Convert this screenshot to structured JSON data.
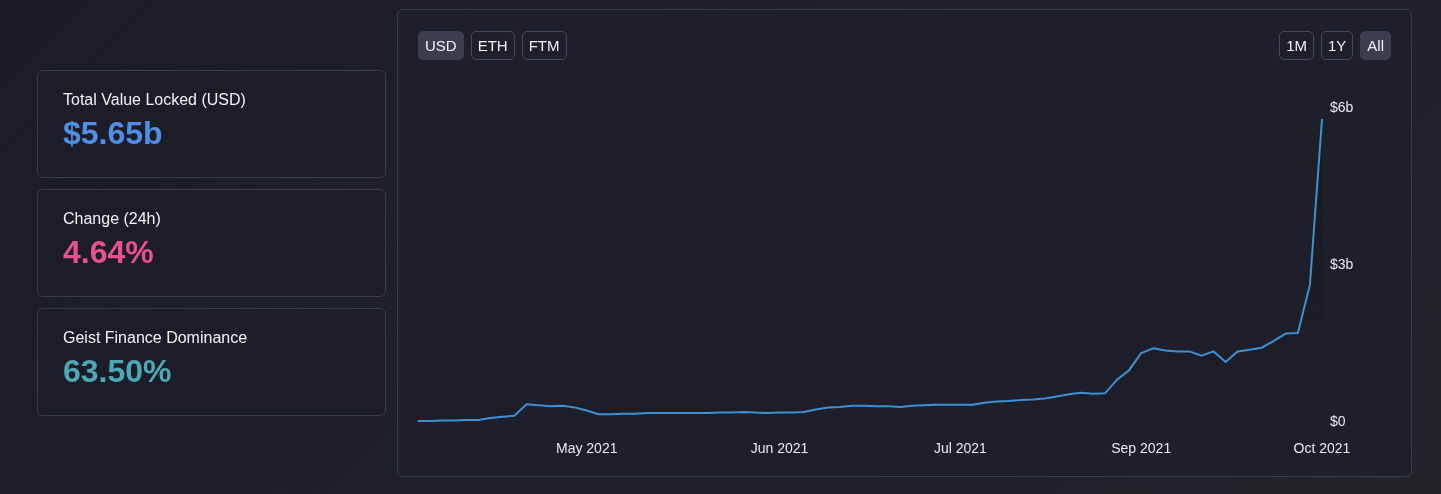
{
  "stats": [
    {
      "label": "Total Value Locked (USD)",
      "value": "$5.65b",
      "color": "#4f8fe6"
    },
    {
      "label": "Change (24h)",
      "value": "4.64%",
      "color": "#e8508f"
    },
    {
      "label": "Geist Finance Dominance",
      "value": "63.50%",
      "color": "#4aa9b4"
    }
  ],
  "chart": {
    "currencies": [
      {
        "label": "USD",
        "selected": true
      },
      {
        "label": "ETH",
        "selected": false
      },
      {
        "label": "FTM",
        "selected": false
      }
    ],
    "ranges": [
      {
        "label": "1M",
        "selected": false
      },
      {
        "label": "1Y",
        "selected": false
      },
      {
        "label": "All",
        "selected": true
      }
    ],
    "chart_data": {
      "type": "line",
      "ylim": [
        0,
        6
      ],
      "categories": [
        null,
        null,
        null,
        null,
        null,
        null,
        null,
        null,
        null,
        null,
        null,
        null,
        null,
        null,
        "May 2021",
        null,
        null,
        null,
        null,
        null,
        null,
        null,
        null,
        null,
        null,
        null,
        null,
        null,
        null,
        null,
        "Jun 2021",
        null,
        null,
        null,
        null,
        null,
        null,
        null,
        null,
        null,
        null,
        null,
        null,
        null,
        null,
        "Jul 2021",
        null,
        null,
        null,
        null,
        null,
        null,
        null,
        null,
        null,
        null,
        null,
        null,
        null,
        null,
        "Sep 2021",
        null,
        null,
        null,
        null,
        null,
        null,
        null,
        null,
        null,
        null,
        null,
        null,
        null,
        null,
        "Oct 2021"
      ],
      "yticks": [
        {
          "value": 0,
          "label": "$0"
        },
        {
          "value": 3,
          "label": "$3b"
        },
        {
          "value": 6,
          "label": "$6b"
        }
      ],
      "series": [
        {
          "color": "#3f8fd2",
          "values": [
            0,
            0,
            0.01,
            0.01,
            0.02,
            0.02,
            0.06,
            0.08,
            0.1,
            0.32,
            0.3,
            0.28,
            0.29,
            0.26,
            0.2,
            0.13,
            0.13,
            0.14,
            0.14,
            0.15,
            0.15,
            0.15,
            0.15,
            0.15,
            0.15,
            0.16,
            0.16,
            0.17,
            0.16,
            0.15,
            0.16,
            0.16,
            0.17,
            0.22,
            0.26,
            0.27,
            0.29,
            0.29,
            0.28,
            0.28,
            0.27,
            0.29,
            0.3,
            0.31,
            0.31,
            0.31,
            0.31,
            0.35,
            0.37,
            0.38,
            0.4,
            0.41,
            0.43,
            0.47,
            0.51,
            0.54,
            0.52,
            0.53,
            0.79,
            0.97,
            1.3,
            1.39,
            1.35,
            1.33,
            1.33,
            1.25,
            1.33,
            1.13,
            1.33,
            1.36,
            1.4,
            1.53,
            1.67,
            1.68,
            2.6,
            5.77
          ]
        }
      ]
    }
  }
}
